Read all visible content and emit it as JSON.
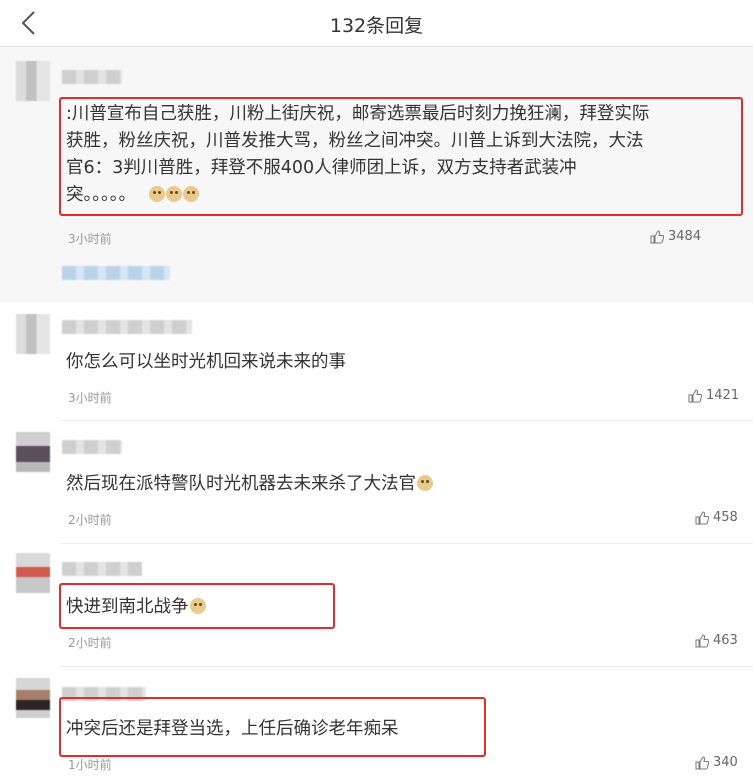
{
  "header": {
    "title": "132条回复"
  },
  "comments": [
    {
      "lines": [
        ":川普宣布自己获胜，川粉上街庆祝，邮寄选票最后时刻力挽狂澜，拜登实际",
        "获胜，粉丝庆祝，川普发推大骂，粉丝之间冲突。川普上诉到大法院，大法",
        "官6：3判川普胜，拜登不服400人律师团上诉，双方支持者武装冲",
        "突。。。。。"
      ],
      "emojis": [
        "doge-emoji",
        "doge-emoji",
        "doge-emoji"
      ],
      "time": "3小时前",
      "likes": "3484"
    },
    {
      "lines": [
        "你怎么可以坐时光机回来说未来的事"
      ],
      "time": "3小时前",
      "likes": "1421"
    },
    {
      "lines": [
        "然后现在派特警队时光机器去未来杀了大法官"
      ],
      "emojis": [
        "doge-emoji"
      ],
      "time": "2小时前",
      "likes": "458"
    },
    {
      "lines": [
        "快进到南北战争"
      ],
      "emojis": [
        "doge-emoji"
      ],
      "time": "2小时前",
      "likes": "463"
    },
    {
      "lines": [
        "冲突后还是拜登当选，上任后确诊老年痴呆"
      ],
      "time": "1小时前",
      "likes": "340"
    }
  ],
  "icons": {
    "back": "chevron-left-icon",
    "like": "thumbs-up-icon"
  },
  "colors": {
    "highlight_box": "#e22d2d",
    "time_text": "#999999"
  }
}
